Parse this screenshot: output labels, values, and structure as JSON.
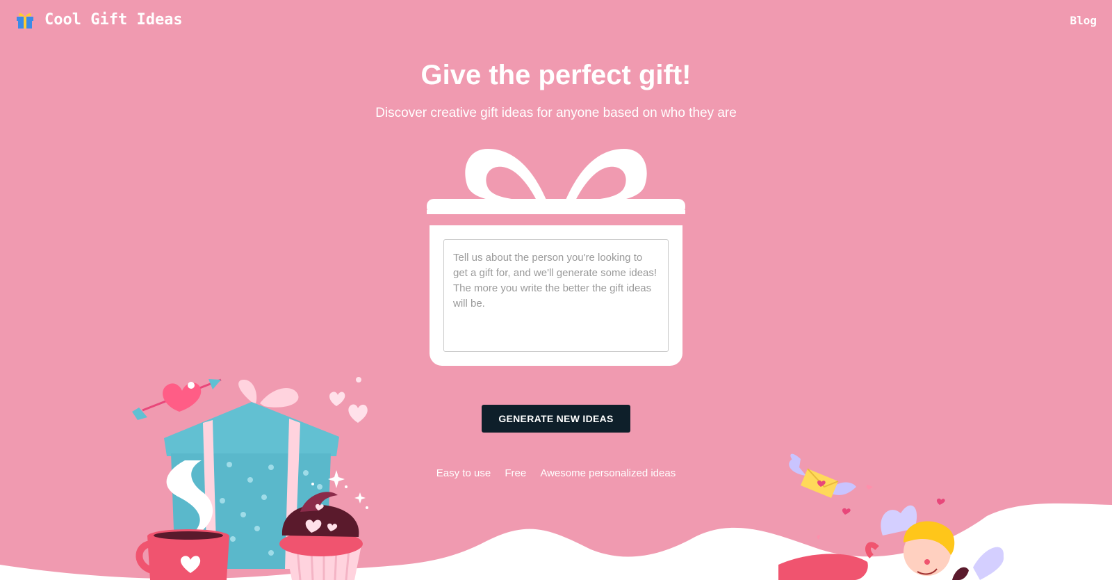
{
  "header": {
    "brand": "Cool Gift Ideas",
    "brand_icon": "wrapped-gift-icon",
    "nav_blog": "Blog"
  },
  "hero": {
    "title": "Give the perfect gift!",
    "subtitle": "Discover creative gift ideas for anyone based on who they are"
  },
  "prompt": {
    "value": "",
    "placeholder": "Tell us about the person you're looking to get a gift for, and we'll generate some ideas! The more you write the better the gift ideas will be."
  },
  "actions": {
    "generate_label": "GENERATE NEW IDEAS"
  },
  "features": [
    "Easy to use",
    "Free",
    "Awesome personalized ideas"
  ],
  "colors": {
    "background": "#f09ab0",
    "button": "#0e1f2a",
    "ground": "#ffffff",
    "gift_blue": "#5fc0d3",
    "heart": "#ff5d86"
  }
}
